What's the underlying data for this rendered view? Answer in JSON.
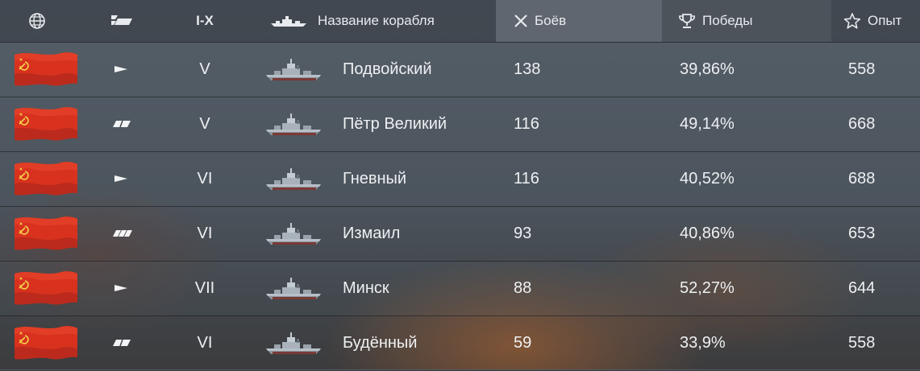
{
  "header": {
    "tier_label": "I-X",
    "ship_name_label": "Название корабля",
    "battles_label": "Боёв",
    "wins_label": "Победы",
    "xp_label": "Опыт",
    "icons": [
      "globe-icon",
      "ship-type-icon",
      "ship-silhouette-icon",
      "crossed-swords-icon",
      "trophy-icon",
      "star-icon"
    ],
    "sorted_column": "battles"
  },
  "rows": [
    {
      "nation": "USSR",
      "type": "destroyer",
      "tier": "V",
      "name": "Подвойский",
      "battles": "138",
      "winrate": "39,86%",
      "xp": "558"
    },
    {
      "nation": "USSR",
      "type": "cruiser",
      "tier": "V",
      "name": "Пётр Великий",
      "battles": "116",
      "winrate": "49,14%",
      "xp": "668"
    },
    {
      "nation": "USSR",
      "type": "destroyer",
      "tier": "VI",
      "name": "Гневный",
      "battles": "116",
      "winrate": "40,52%",
      "xp": "688"
    },
    {
      "nation": "USSR",
      "type": "battleship",
      "tier": "VI",
      "name": "Измаил",
      "battles": "93",
      "winrate": "40,86%",
      "xp": "653"
    },
    {
      "nation": "USSR",
      "type": "destroyer",
      "tier": "VII",
      "name": "Минск",
      "battles": "88",
      "winrate": "52,27%",
      "xp": "644"
    },
    {
      "nation": "USSR",
      "type": "cruiser",
      "tier": "VI",
      "name": "Будённый",
      "battles": "59",
      "winrate": "33,9%",
      "xp": "558"
    }
  ],
  "colors": {
    "flag": "#d8321f",
    "header_bg": "#3c424a",
    "text": "#e9ecef"
  }
}
